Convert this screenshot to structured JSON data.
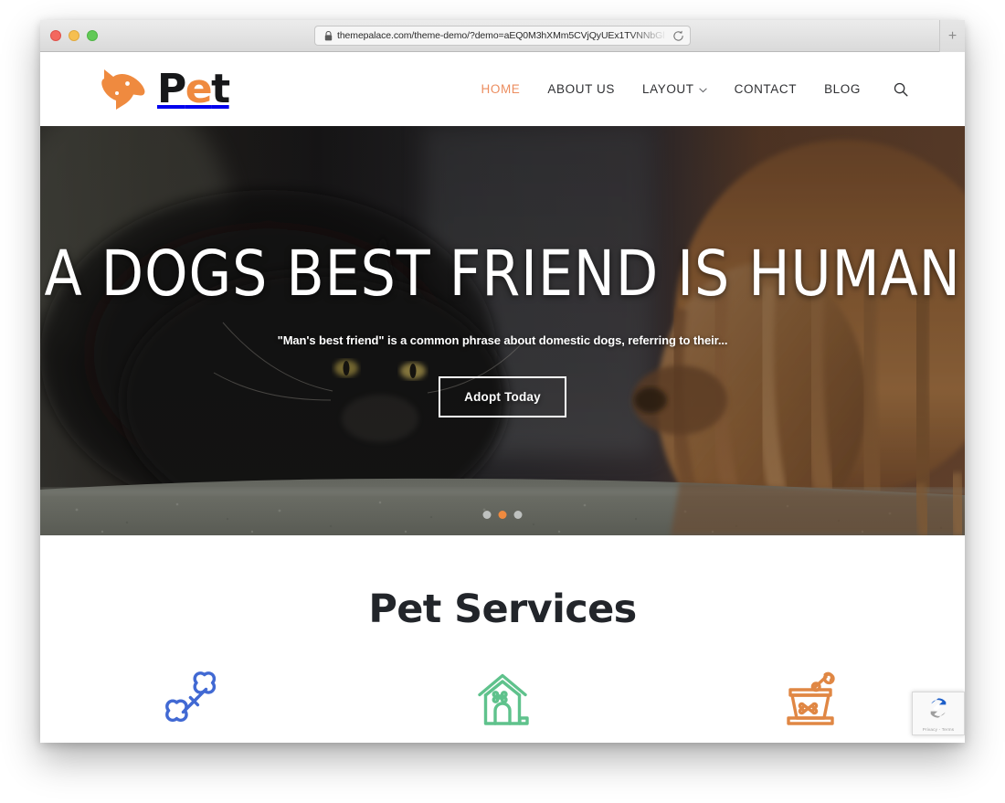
{
  "browser": {
    "url": "themepalace.com/theme-demo/?demo=aEQ0M3hXMm5CVjQyUEx1TVNNbGl",
    "lock_icon": "lock-icon",
    "reload_icon": "reload-icon",
    "newtab_label": "+",
    "traffic_lights": [
      "close",
      "minimize",
      "maximize"
    ]
  },
  "site": {
    "logo": {
      "mark": "dog-head-icon",
      "text_part1": "P",
      "text_accent": "e",
      "text_part2": "t"
    },
    "nav": {
      "items": [
        {
          "label": "HOME",
          "active": true,
          "has_caret": false
        },
        {
          "label": "ABOUT US",
          "active": false,
          "has_caret": false
        },
        {
          "label": "LAYOUT",
          "active": false,
          "has_caret": true
        },
        {
          "label": "CONTACT",
          "active": false,
          "has_caret": false
        },
        {
          "label": "BLOG",
          "active": false,
          "has_caret": false
        }
      ],
      "search_icon": "search-icon"
    }
  },
  "hero": {
    "title": "A DOGS BEST FRIEND IS HUMAN",
    "subtitle": "\"Man's best friend\" is a common phrase about domestic dogs, referring to their...",
    "cta_label": "Adopt Today",
    "slides_total": 3,
    "active_slide": 2,
    "image_description": "black cat and ginger dog lying on gray carpet"
  },
  "services": {
    "title": "Pet Services",
    "items": [
      {
        "icon": "dog-bone-icon",
        "color": "#4169D3"
      },
      {
        "icon": "dog-house-icon",
        "color": "#5FC28C"
      },
      {
        "icon": "food-bowl-icon",
        "color": "#E08744"
      }
    ]
  },
  "recaptcha": {
    "logo_icon": "recaptcha-icon",
    "links": "Privacy - Terms"
  },
  "colors": {
    "brand_orange": "#ef8a3f",
    "nav_active": "#ec8d5f",
    "heading_dark": "#22252a",
    "bone_blue": "#4169D3",
    "house_green": "#5FC28C",
    "bowl_orange": "#E08744"
  }
}
